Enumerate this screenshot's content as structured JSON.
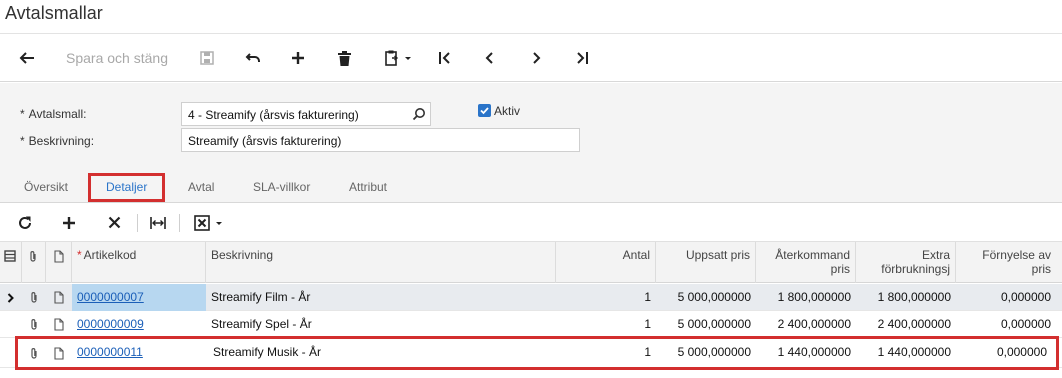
{
  "page": {
    "title": "Avtalsmallar"
  },
  "toolbar": {
    "save_close_label": "Spara och stäng",
    "icons": [
      "back-icon",
      "save-icon",
      "undo-icon",
      "add-icon",
      "delete-icon",
      "copy-paste-icon",
      "first-icon",
      "previous-icon",
      "next-icon",
      "last-icon"
    ]
  },
  "form": {
    "template_label": "Avtalsmall:",
    "template_value": "4 - Streamify (årsvis fakturering)",
    "description_label": "Beskrivning:",
    "description_value": "Streamify (årsvis fakturering)",
    "active_label": "Aktiv",
    "active_checked": true,
    "required_mark": "*"
  },
  "tabs": [
    {
      "label": "Översikt",
      "active": false
    },
    {
      "label": "Detaljer",
      "active": true
    },
    {
      "label": "Avtal",
      "active": false
    },
    {
      "label": "SLA-villkor",
      "active": false
    },
    {
      "label": "Attribut",
      "active": false
    }
  ],
  "grid_toolbar": {
    "icons": [
      "refresh-icon",
      "add-row-icon",
      "delete-row-icon",
      "fit-columns-icon",
      "excel-export-icon"
    ]
  },
  "grid": {
    "required_mark": "*",
    "columns": {
      "item_code": "Artikelkod",
      "description": "Beskrivning",
      "quantity": "Antal",
      "setup_price": "Uppsatt pris",
      "recurring_price_1": "Återkommand",
      "recurring_price_2": "pris",
      "extra_usage_1": "Extra",
      "extra_usage_2": "förbrukningsj",
      "renewal_1": "Förnyelse av",
      "renewal_2": "pris"
    },
    "rows": [
      {
        "item_code": "0000000007",
        "description": "Streamify Film - År",
        "quantity": "1",
        "setup_price": "5 000,000000",
        "recurring_price": "1 800,000000",
        "extra_usage": "1 800,000000",
        "renewal": "0,000000"
      },
      {
        "item_code": "0000000009",
        "description": "Streamify Spel - År",
        "quantity": "1",
        "setup_price": "5 000,000000",
        "recurring_price": "2 400,000000",
        "extra_usage": "2 400,000000",
        "renewal": "0,000000"
      },
      {
        "item_code": "0000000011",
        "description": "Streamify Musik - År",
        "quantity": "1",
        "setup_price": "5 000,000000",
        "recurring_price": "1 440,000000",
        "extra_usage": "1 440,000000",
        "renewal": "0,000000"
      }
    ]
  },
  "colors": {
    "accent": "#2a74c9",
    "highlight": "#d32f2f",
    "link": "#1b5fb8"
  }
}
